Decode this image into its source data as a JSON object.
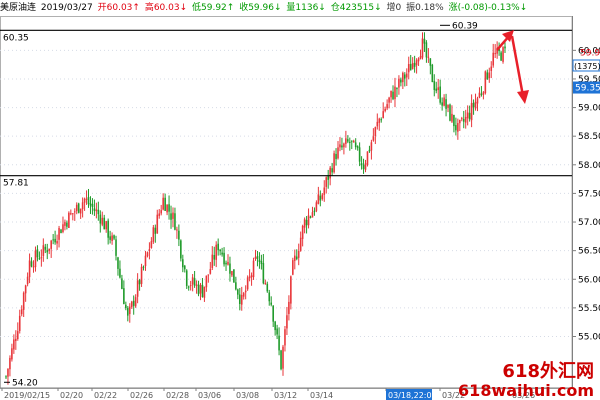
{
  "header": {
    "title": "美原油连",
    "date": "2019/03/27",
    "open": "开60.03↑",
    "high": "高60.03↓",
    "low": "低59.92↑",
    "close": "收59.96↓",
    "volume": "量1136↓",
    "position": "仓423515↓",
    "amplitude": "增0",
    "range": "振0.18%",
    "change": "涨(-0.08)-0.13%↓"
  },
  "labels": {
    "high_price": "60.35",
    "mid_price": "57.81",
    "low_price": "54.20",
    "peak_price": "60.39",
    "last_price": "59.96",
    "count": "(1375)",
    "current_box": "59.35",
    "time_box": "03/18,22:00"
  },
  "watermark": {
    "line1": "618外汇网",
    "line2": "618waihui.com"
  },
  "colors": {
    "up": "#e8363a",
    "down": "#1f9a2a",
    "arrow": "#e8202a",
    "highlight": "#1e73d6"
  },
  "chart_data": {
    "type": "candlestick",
    "title": "美原油连",
    "ylim": [
      54.1,
      60.6
    ],
    "yticks": [
      55.0,
      55.5,
      56.0,
      56.5,
      57.0,
      57.5,
      58.0,
      58.5,
      59.0,
      59.5,
      60.0
    ],
    "xticks": [
      "2019/02/15",
      "02/20",
      "02/22",
      "02/26",
      "02/28",
      "03/06",
      "03/08",
      "03/12",
      "03/14",
      "03/18,22:00",
      "03/22",
      "03/26"
    ],
    "horizontal_lines": [
      60.35,
      57.81
    ],
    "last_price": 59.96,
    "approx_close_path": [
      [
        0,
        54.3
      ],
      [
        6,
        55.2
      ],
      [
        12,
        56.3
      ],
      [
        20,
        56.5
      ],
      [
        30,
        57.0
      ],
      [
        40,
        57.4
      ],
      [
        48,
        57.1
      ],
      [
        55,
        56.6
      ],
      [
        62,
        55.3
      ],
      [
        70,
        56.2
      ],
      [
        80,
        57.4
      ],
      [
        86,
        57.0
      ],
      [
        92,
        56.0
      ],
      [
        100,
        55.8
      ],
      [
        108,
        56.6
      ],
      [
        114,
        56.2
      ],
      [
        120,
        55.6
      ],
      [
        128,
        56.4
      ],
      [
        135,
        55.6
      ],
      [
        140,
        54.5
      ],
      [
        146,
        56.2
      ],
      [
        152,
        57.0
      ],
      [
        160,
        57.4
      ],
      [
        168,
        58.2
      ],
      [
        175,
        58.4
      ],
      [
        182,
        58.0
      ],
      [
        190,
        58.8
      ],
      [
        196,
        59.2
      ],
      [
        204,
        59.6
      ],
      [
        212,
        60.1
      ],
      [
        218,
        59.4
      ],
      [
        224,
        59.0
      ],
      [
        230,
        58.6
      ],
      [
        236,
        58.9
      ],
      [
        242,
        59.3
      ],
      [
        248,
        59.9
      ],
      [
        254,
        59.96
      ]
    ]
  }
}
